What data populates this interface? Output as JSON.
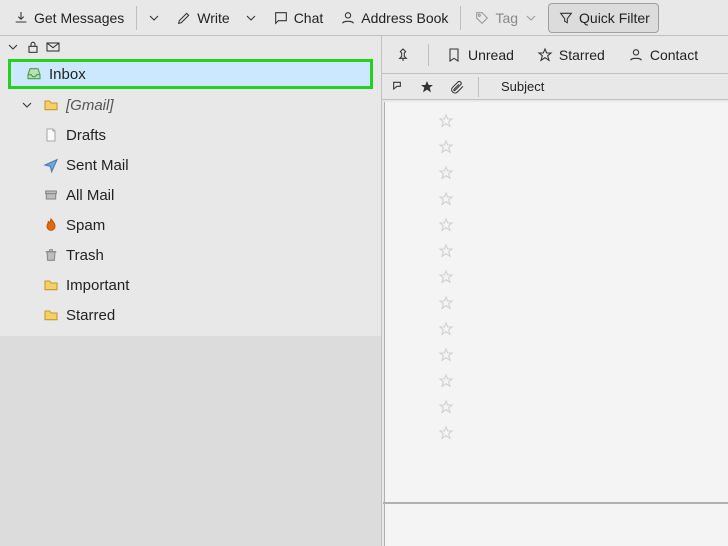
{
  "toolbar": {
    "get_messages": "Get Messages",
    "write": "Write",
    "chat": "Chat",
    "address_book": "Address Book",
    "tag": "Tag",
    "quick_filter": "Quick Filter"
  },
  "sidebar": {
    "inbox": "Inbox",
    "gmail": "[Gmail]",
    "drafts": "Drafts",
    "sent": "Sent Mail",
    "all": "All Mail",
    "spam": "Spam",
    "trash": "Trash",
    "important": "Important",
    "starred": "Starred"
  },
  "filter": {
    "unread": "Unread",
    "starred": "Starred",
    "contact": "Contact"
  },
  "columns": {
    "subject": "Subject"
  }
}
